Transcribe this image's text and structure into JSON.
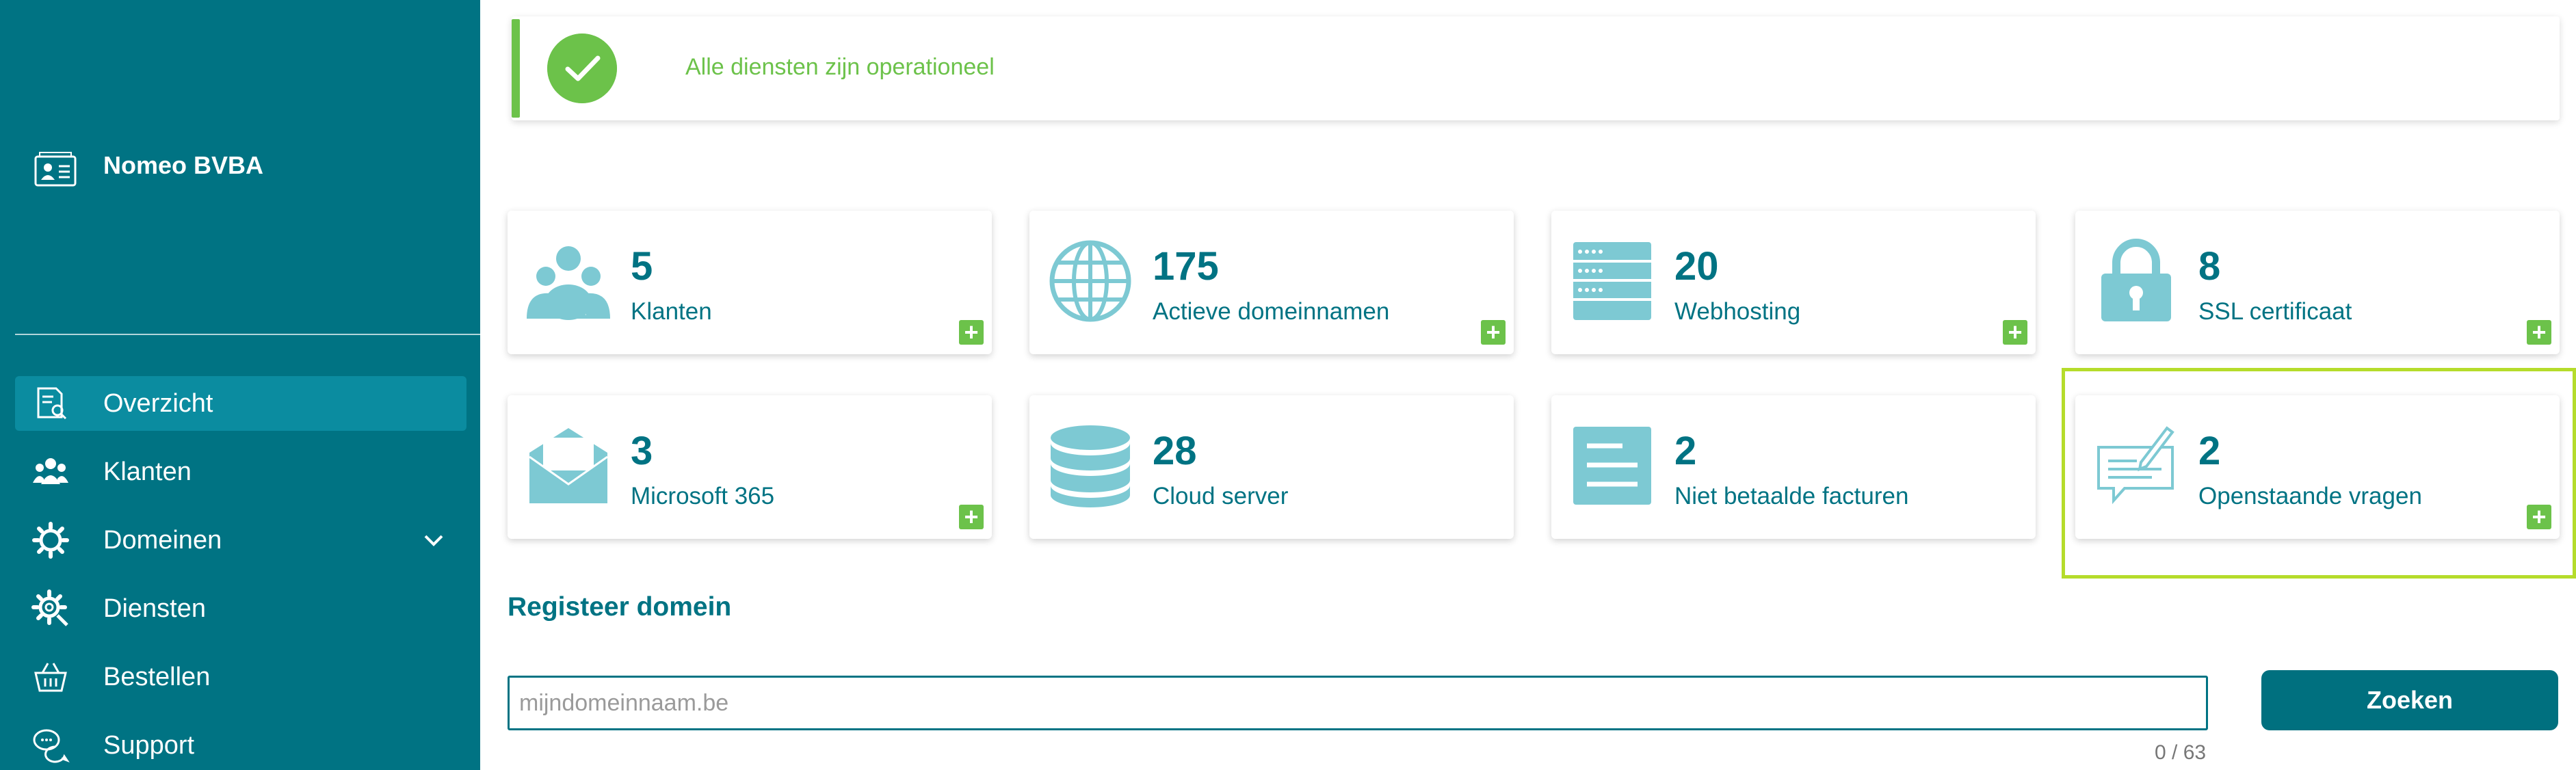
{
  "sidebar": {
    "org_name": "Nomeo BVBA",
    "org_icon": "contact-card-icon",
    "items": [
      {
        "label": "Overzicht",
        "icon": "overview-document-icon",
        "active": true
      },
      {
        "label": "Klanten",
        "icon": "users-icon"
      },
      {
        "label": "Domeinen",
        "icon": "gear-icon",
        "has_dropdown": true
      },
      {
        "label": "Diensten",
        "icon": "gear-search-icon"
      },
      {
        "label": "Bestellen",
        "icon": "basket-icon"
      },
      {
        "label": "Support",
        "icon": "chat-bubbles-icon"
      }
    ]
  },
  "status": {
    "message": "Alle diensten zijn operationeel",
    "icon": "check-circle-icon"
  },
  "cards": [
    {
      "count": "5",
      "label": "Klanten",
      "icon": "people-group-icon"
    },
    {
      "count": "175",
      "label": "Actieve domeinnamen",
      "icon": "globe-icon"
    },
    {
      "count": "20",
      "label": "Webhosting",
      "icon": "server-rack-icon"
    },
    {
      "count": "8",
      "label": "SSL certificaat",
      "icon": "padlock-icon"
    },
    {
      "count": "3",
      "label": "Microsoft 365",
      "icon": "envelope-icon"
    },
    {
      "count": "28",
      "label": "Cloud server",
      "icon": "database-icon"
    },
    {
      "count": "2",
      "label": "Niet betaalde facturen",
      "icon": "invoice-lines-icon"
    },
    {
      "count": "2",
      "label": "Openstaande vragen",
      "icon": "speech-pen-icon"
    }
  ],
  "register": {
    "title": "Registeer domein",
    "placeholder": "mijndomeinnaam.be",
    "counter": "0 / 63",
    "button_label": "Zoeken"
  },
  "colors": {
    "brand": "#007383",
    "accent_green": "#6cc24a",
    "highlight": "#b5dc2b",
    "icon_teal": "#7dc9d3"
  }
}
